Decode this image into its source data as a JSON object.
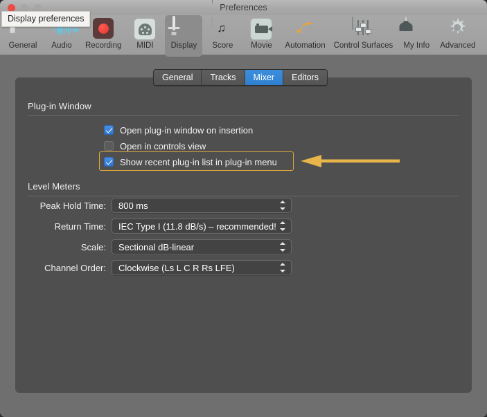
{
  "window": {
    "title": "Preferences",
    "traffic_lights": [
      "close",
      "minimize",
      "zoom"
    ]
  },
  "tooltip": {
    "text": "Display preferences"
  },
  "toolbar": {
    "items": [
      {
        "label": "General",
        "icon": "general-icon",
        "selected": false
      },
      {
        "label": "Audio",
        "icon": "audio-waveform-icon",
        "selected": false
      },
      {
        "label": "Recording",
        "icon": "record-icon",
        "selected": false
      },
      {
        "label": "MIDI",
        "icon": "midi-din-icon",
        "selected": false
      },
      {
        "label": "Display",
        "icon": "display-monitor-icon",
        "selected": true
      },
      {
        "label": "Score",
        "icon": "score-note-icon",
        "selected": false
      },
      {
        "label": "Movie",
        "icon": "movie-camera-icon",
        "selected": false
      },
      {
        "label": "Automation",
        "icon": "automation-curve-icon",
        "selected": false
      },
      {
        "label": "Control Surfaces",
        "icon": "faders-icon",
        "selected": false
      },
      {
        "label": "My Info",
        "icon": "person-icon",
        "selected": false
      },
      {
        "label": "Advanced",
        "icon": "gear-icon",
        "selected": false
      }
    ]
  },
  "tabs": [
    {
      "label": "General",
      "active": false
    },
    {
      "label": "Tracks",
      "active": false
    },
    {
      "label": "Mixer",
      "active": true
    },
    {
      "label": "Editors",
      "active": false
    }
  ],
  "sections": {
    "plugin_window": {
      "title": "Plug-in Window",
      "checkboxes": [
        {
          "label": "Open plug-in window on insertion",
          "checked": true,
          "highlighted": false
        },
        {
          "label": "Open in controls view",
          "checked": false,
          "highlighted": false
        },
        {
          "label": "Show recent plug-in list in plug-in menu",
          "checked": true,
          "highlighted": true
        }
      ]
    },
    "level_meters": {
      "title": "Level Meters",
      "fields": [
        {
          "label": "Peak Hold Time:",
          "value": "800 ms"
        },
        {
          "label": "Return Time:",
          "value": "IEC Type I (11.8 dB/s) – recommended!"
        },
        {
          "label": "Scale:",
          "value": "Sectional dB-linear"
        },
        {
          "label": "Channel Order:",
          "value": "Clockwise (Ls L C R Rs LFE)"
        }
      ]
    }
  },
  "annotation": {
    "arrow_color": "#e8b54a",
    "highlight_color": "#e0a93b",
    "direction": "left"
  },
  "colors": {
    "accent_blue": "#3d8fdd",
    "panel_bg": "#4f4f4f",
    "window_bg": "#6f6f6f",
    "titlebar": "#a9a9a9",
    "close_button": "#ea4b44"
  }
}
